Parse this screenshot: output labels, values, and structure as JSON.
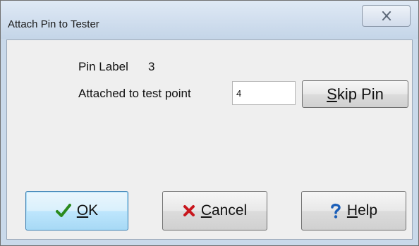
{
  "window": {
    "title": "Attach Pin to Tester"
  },
  "titlebar_buttons": {
    "close_icon": "close-x-icon"
  },
  "fields": {
    "pin_label_caption": "Pin Label",
    "pin_label_value": "3",
    "test_point_caption": "Attached to test point",
    "test_point_value": "4"
  },
  "buttons": {
    "skip_pin": {
      "accel": "S",
      "rest": "kip Pin"
    },
    "ok": {
      "accel": "O",
      "rest": "K",
      "icon": "checkmark-icon",
      "icon_color": "#2a8a1e"
    },
    "cancel": {
      "accel": "C",
      "rest": "ancel",
      "icon": "red-x-icon",
      "icon_color": "#c8161d"
    },
    "help": {
      "accel": "H",
      "rest": "elp",
      "icon": "question-mark-icon",
      "icon_color": "#1c5fb8"
    }
  },
  "colors": {
    "title_gradient_top": "#dfe9f5",
    "title_gradient_bottom": "#c4d5e8",
    "client_background": "#efefef",
    "default_button_border": "#3c7fb1"
  }
}
